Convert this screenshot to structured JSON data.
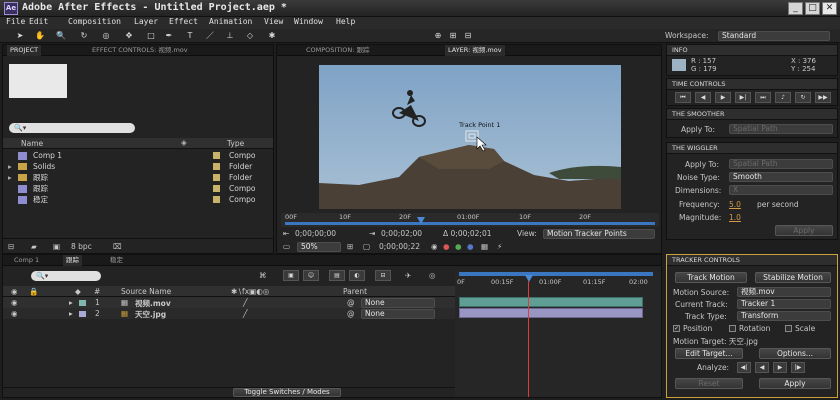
{
  "window": {
    "title": "Adobe After Effects - Untitled Project.aep *",
    "icon": "Ae",
    "min": "_",
    "max": "□",
    "close": "✕"
  },
  "menu": [
    "File",
    "Edit",
    "Composition",
    "Layer",
    "Effect",
    "Animation",
    "View",
    "Window",
    "Help"
  ],
  "workspace": {
    "label": "Workspace:",
    "value": "Standard"
  },
  "project_panel": {
    "tabs": [
      "PROJECT",
      "EFFECT CONTROLS: 视频.mov"
    ],
    "columns": {
      "name": "Name",
      "type": "Type"
    },
    "items": [
      {
        "name": "Comp 1",
        "type": "Compo",
        "icon": "comp-icon"
      },
      {
        "name": "Solids",
        "type": "Folder",
        "icon": "folder-icon"
      },
      {
        "name": "跟踪",
        "type": "Folder",
        "icon": "folder-icon"
      },
      {
        "name": "跟踪",
        "type": "Compo",
        "icon": "comp-icon"
      },
      {
        "name": "稳定",
        "type": "Compo",
        "icon": "comp-icon"
      }
    ],
    "bpc": "8 bpc"
  },
  "viewer": {
    "tabs": [
      "COMPOSITION: 跟踪",
      "LAYER: 视频.mov"
    ],
    "track_point": "Track Point 1",
    "ruler": [
      "00F",
      "10F",
      "20F",
      "01:00F",
      "10F",
      "20F"
    ],
    "time_start": "0;00;00;00",
    "time_current": "0;00;02;00",
    "time_delta": "Δ 0;00;02;01",
    "view_label": "View:",
    "view_value": "Motion Tracker Points",
    "zoom": "50%",
    "timecode": "0;00;00;22"
  },
  "info": {
    "title": "INFO",
    "r": "R : 157",
    "g": "G : 179",
    "b": "B : 195",
    "a": "A : 255",
    "x": "X : 376",
    "y": "Y : 254"
  },
  "time_controls": {
    "title": "TIME CONTROLS"
  },
  "smoother": {
    "title": "THE SMOOTHER",
    "apply_to_label": "Apply To:",
    "apply_to_value": "Spatial Path"
  },
  "wiggler": {
    "title": "THE WIGGLER",
    "apply_to_label": "Apply To:",
    "apply_to_value": "Spatial Path",
    "noise_label": "Noise Type:",
    "noise_value": "Smooth",
    "dim_label": "Dimensions:",
    "dim_value": "X",
    "freq_label": "Frequency:",
    "freq_value": "5.0",
    "freq_unit": "per second",
    "mag_label": "Magnitude:",
    "mag_value": "1.0",
    "apply": "Apply"
  },
  "tracker": {
    "title": "TRACKER CONTROLS",
    "track_motion": "Track Motion",
    "stabilize": "Stabilize Motion",
    "source_label": "Motion Source:",
    "source_value": "视频.mov",
    "current_label": "Current Track:",
    "current_value": "Tracker 1",
    "type_label": "Track Type:",
    "type_value": "Transform",
    "position": "Position",
    "rotation": "Rotation",
    "scale": "Scale",
    "target": "Motion Target: 天空.jpg",
    "edit_target": "Edit Target...",
    "options": "Options...",
    "analyze_label": "Analyze:",
    "reset": "Reset",
    "apply": "Apply"
  },
  "timeline": {
    "tabs": [
      "Comp 1",
      "跟踪",
      "稳定"
    ],
    "col_source": "Source Name",
    "col_parent": "Parent",
    "hash": "#",
    "ruler": [
      "0F",
      "00:15F",
      "01:00F",
      "01:15F",
      "02:00"
    ],
    "layers": [
      {
        "num": "1",
        "name": "视频.mov",
        "parent": "None"
      },
      {
        "num": "2",
        "name": "天空.jpg",
        "parent": "None"
      }
    ],
    "toggle": "Toggle Switches / Modes"
  }
}
